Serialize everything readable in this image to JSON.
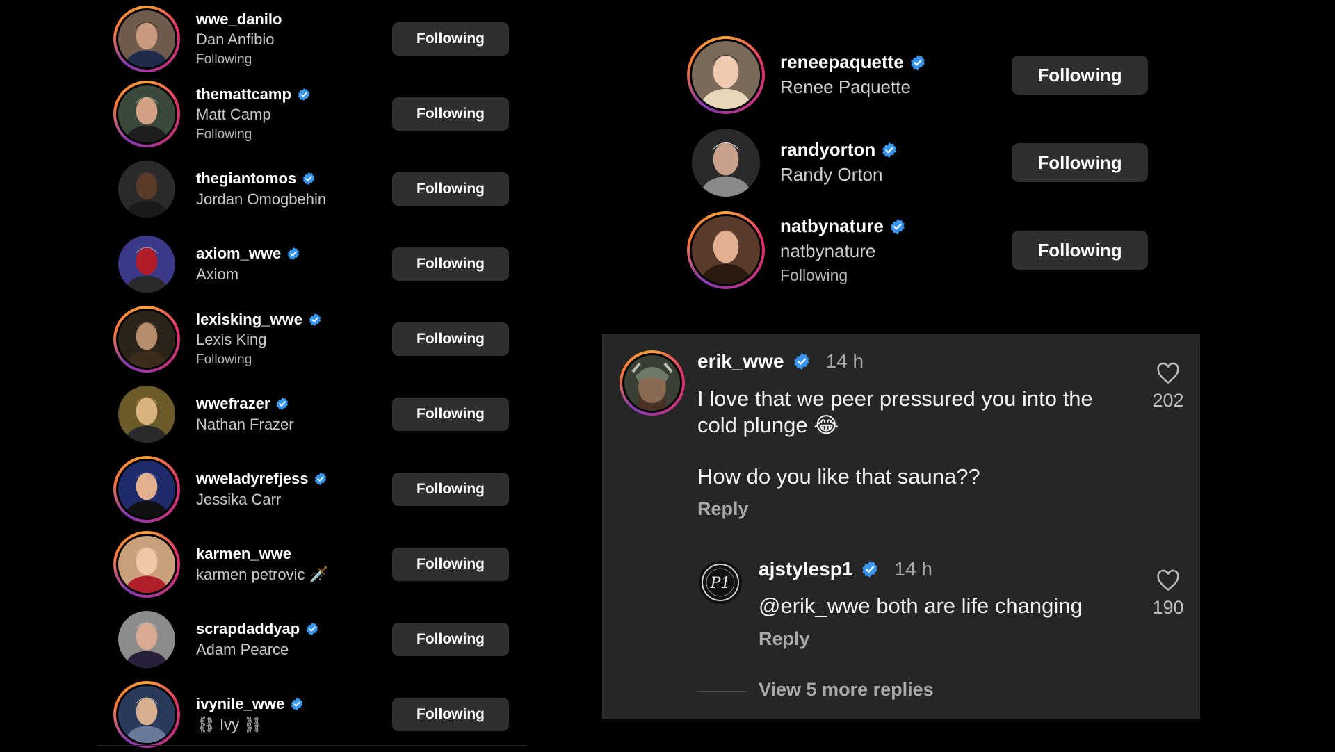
{
  "left_following": [
    {
      "username": "wwe_danilo",
      "verified": false,
      "full_name": "Dan Anfibio",
      "status": "Following",
      "button": "Following",
      "ring": true
    },
    {
      "username": "themattcamp",
      "verified": true,
      "full_name": "Matt Camp",
      "status": "Following",
      "button": "Following",
      "ring": true
    },
    {
      "username": "thegiantomos",
      "verified": true,
      "full_name": "Jordan Omogbehin",
      "status": "",
      "button": "Following",
      "ring": false
    },
    {
      "username": "axiom_wwe",
      "verified": true,
      "full_name": "Axiom",
      "status": "",
      "button": "Following",
      "ring": false
    },
    {
      "username": "lexisking_wwe",
      "verified": true,
      "full_name": "Lexis King",
      "status": "Following",
      "button": "Following",
      "ring": true
    },
    {
      "username": "wwefrazer",
      "verified": true,
      "full_name": "Nathan Frazer",
      "status": "",
      "button": "Following",
      "ring": false
    },
    {
      "username": "wweladyrefjess",
      "verified": true,
      "full_name": "Jessika Carr",
      "status": "",
      "button": "Following",
      "ring": true
    },
    {
      "username": "karmen_wwe",
      "verified": false,
      "full_name": "karmen petrovic 🗡️",
      "status": "",
      "button": "Following",
      "ring": true
    },
    {
      "username": "scrapdaddyap",
      "verified": true,
      "full_name": "Adam Pearce",
      "status": "",
      "button": "Following",
      "ring": false
    },
    {
      "username": "ivynile_wwe",
      "verified": true,
      "full_name": "⛓ Ivy ⛓",
      "status": "",
      "button": "Following",
      "ring": true
    }
  ],
  "right_following": [
    {
      "username": "reneepaquette",
      "verified": true,
      "full_name": "Renee Paquette",
      "status": "",
      "button": "Following",
      "ring": true
    },
    {
      "username": "randyorton",
      "verified": true,
      "full_name": "Randy Orton",
      "status": "",
      "button": "Following",
      "ring": false
    },
    {
      "username": "natbynature",
      "verified": true,
      "full_name": "natbynature",
      "status": "Following",
      "button": "Following",
      "ring": true
    }
  ],
  "comments": {
    "main": {
      "username": "erik_wwe",
      "time": "14 h",
      "text_line1": "I love that we peer pressured you into the",
      "text_line2": "cold plunge 😂",
      "text_line3": "How do you like that sauna??",
      "reply_label": "Reply",
      "likes": "202"
    },
    "reply": {
      "username": "ajstylesp1",
      "time": "14 h",
      "text": "@erik_wwe both are life changing",
      "reply_label": "Reply",
      "likes": "190"
    },
    "view_more": "View 5 more replies"
  },
  "colors": {
    "background": "#000000",
    "button": "#2f2f2f",
    "verified": "#3897f0",
    "panel": "#262626",
    "muted_text": "#a9a9a9"
  }
}
